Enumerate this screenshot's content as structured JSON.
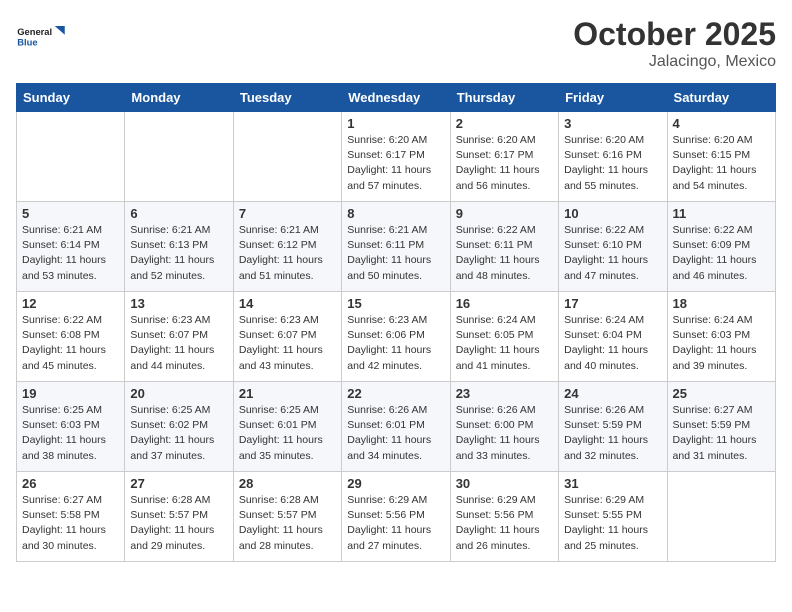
{
  "header": {
    "logo_line1": "General",
    "logo_line2": "Blue",
    "month": "October 2025",
    "location": "Jalacingo, Mexico"
  },
  "weekdays": [
    "Sunday",
    "Monday",
    "Tuesday",
    "Wednesday",
    "Thursday",
    "Friday",
    "Saturday"
  ],
  "weeks": [
    [
      {
        "day": "",
        "info": ""
      },
      {
        "day": "",
        "info": ""
      },
      {
        "day": "",
        "info": ""
      },
      {
        "day": "1",
        "info": "Sunrise: 6:20 AM\nSunset: 6:17 PM\nDaylight: 11 hours\nand 57 minutes."
      },
      {
        "day": "2",
        "info": "Sunrise: 6:20 AM\nSunset: 6:17 PM\nDaylight: 11 hours\nand 56 minutes."
      },
      {
        "day": "3",
        "info": "Sunrise: 6:20 AM\nSunset: 6:16 PM\nDaylight: 11 hours\nand 55 minutes."
      },
      {
        "day": "4",
        "info": "Sunrise: 6:20 AM\nSunset: 6:15 PM\nDaylight: 11 hours\nand 54 minutes."
      }
    ],
    [
      {
        "day": "5",
        "info": "Sunrise: 6:21 AM\nSunset: 6:14 PM\nDaylight: 11 hours\nand 53 minutes."
      },
      {
        "day": "6",
        "info": "Sunrise: 6:21 AM\nSunset: 6:13 PM\nDaylight: 11 hours\nand 52 minutes."
      },
      {
        "day": "7",
        "info": "Sunrise: 6:21 AM\nSunset: 6:12 PM\nDaylight: 11 hours\nand 51 minutes."
      },
      {
        "day": "8",
        "info": "Sunrise: 6:21 AM\nSunset: 6:11 PM\nDaylight: 11 hours\nand 50 minutes."
      },
      {
        "day": "9",
        "info": "Sunrise: 6:22 AM\nSunset: 6:11 PM\nDaylight: 11 hours\nand 48 minutes."
      },
      {
        "day": "10",
        "info": "Sunrise: 6:22 AM\nSunset: 6:10 PM\nDaylight: 11 hours\nand 47 minutes."
      },
      {
        "day": "11",
        "info": "Sunrise: 6:22 AM\nSunset: 6:09 PM\nDaylight: 11 hours\nand 46 minutes."
      }
    ],
    [
      {
        "day": "12",
        "info": "Sunrise: 6:22 AM\nSunset: 6:08 PM\nDaylight: 11 hours\nand 45 minutes."
      },
      {
        "day": "13",
        "info": "Sunrise: 6:23 AM\nSunset: 6:07 PM\nDaylight: 11 hours\nand 44 minutes."
      },
      {
        "day": "14",
        "info": "Sunrise: 6:23 AM\nSunset: 6:07 PM\nDaylight: 11 hours\nand 43 minutes."
      },
      {
        "day": "15",
        "info": "Sunrise: 6:23 AM\nSunset: 6:06 PM\nDaylight: 11 hours\nand 42 minutes."
      },
      {
        "day": "16",
        "info": "Sunrise: 6:24 AM\nSunset: 6:05 PM\nDaylight: 11 hours\nand 41 minutes."
      },
      {
        "day": "17",
        "info": "Sunrise: 6:24 AM\nSunset: 6:04 PM\nDaylight: 11 hours\nand 40 minutes."
      },
      {
        "day": "18",
        "info": "Sunrise: 6:24 AM\nSunset: 6:03 PM\nDaylight: 11 hours\nand 39 minutes."
      }
    ],
    [
      {
        "day": "19",
        "info": "Sunrise: 6:25 AM\nSunset: 6:03 PM\nDaylight: 11 hours\nand 38 minutes."
      },
      {
        "day": "20",
        "info": "Sunrise: 6:25 AM\nSunset: 6:02 PM\nDaylight: 11 hours\nand 37 minutes."
      },
      {
        "day": "21",
        "info": "Sunrise: 6:25 AM\nSunset: 6:01 PM\nDaylight: 11 hours\nand 35 minutes."
      },
      {
        "day": "22",
        "info": "Sunrise: 6:26 AM\nSunset: 6:01 PM\nDaylight: 11 hours\nand 34 minutes."
      },
      {
        "day": "23",
        "info": "Sunrise: 6:26 AM\nSunset: 6:00 PM\nDaylight: 11 hours\nand 33 minutes."
      },
      {
        "day": "24",
        "info": "Sunrise: 6:26 AM\nSunset: 5:59 PM\nDaylight: 11 hours\nand 32 minutes."
      },
      {
        "day": "25",
        "info": "Sunrise: 6:27 AM\nSunset: 5:59 PM\nDaylight: 11 hours\nand 31 minutes."
      }
    ],
    [
      {
        "day": "26",
        "info": "Sunrise: 6:27 AM\nSunset: 5:58 PM\nDaylight: 11 hours\nand 30 minutes."
      },
      {
        "day": "27",
        "info": "Sunrise: 6:28 AM\nSunset: 5:57 PM\nDaylight: 11 hours\nand 29 minutes."
      },
      {
        "day": "28",
        "info": "Sunrise: 6:28 AM\nSunset: 5:57 PM\nDaylight: 11 hours\nand 28 minutes."
      },
      {
        "day": "29",
        "info": "Sunrise: 6:29 AM\nSunset: 5:56 PM\nDaylight: 11 hours\nand 27 minutes."
      },
      {
        "day": "30",
        "info": "Sunrise: 6:29 AM\nSunset: 5:56 PM\nDaylight: 11 hours\nand 26 minutes."
      },
      {
        "day": "31",
        "info": "Sunrise: 6:29 AM\nSunset: 5:55 PM\nDaylight: 11 hours\nand 25 minutes."
      },
      {
        "day": "",
        "info": ""
      }
    ]
  ]
}
